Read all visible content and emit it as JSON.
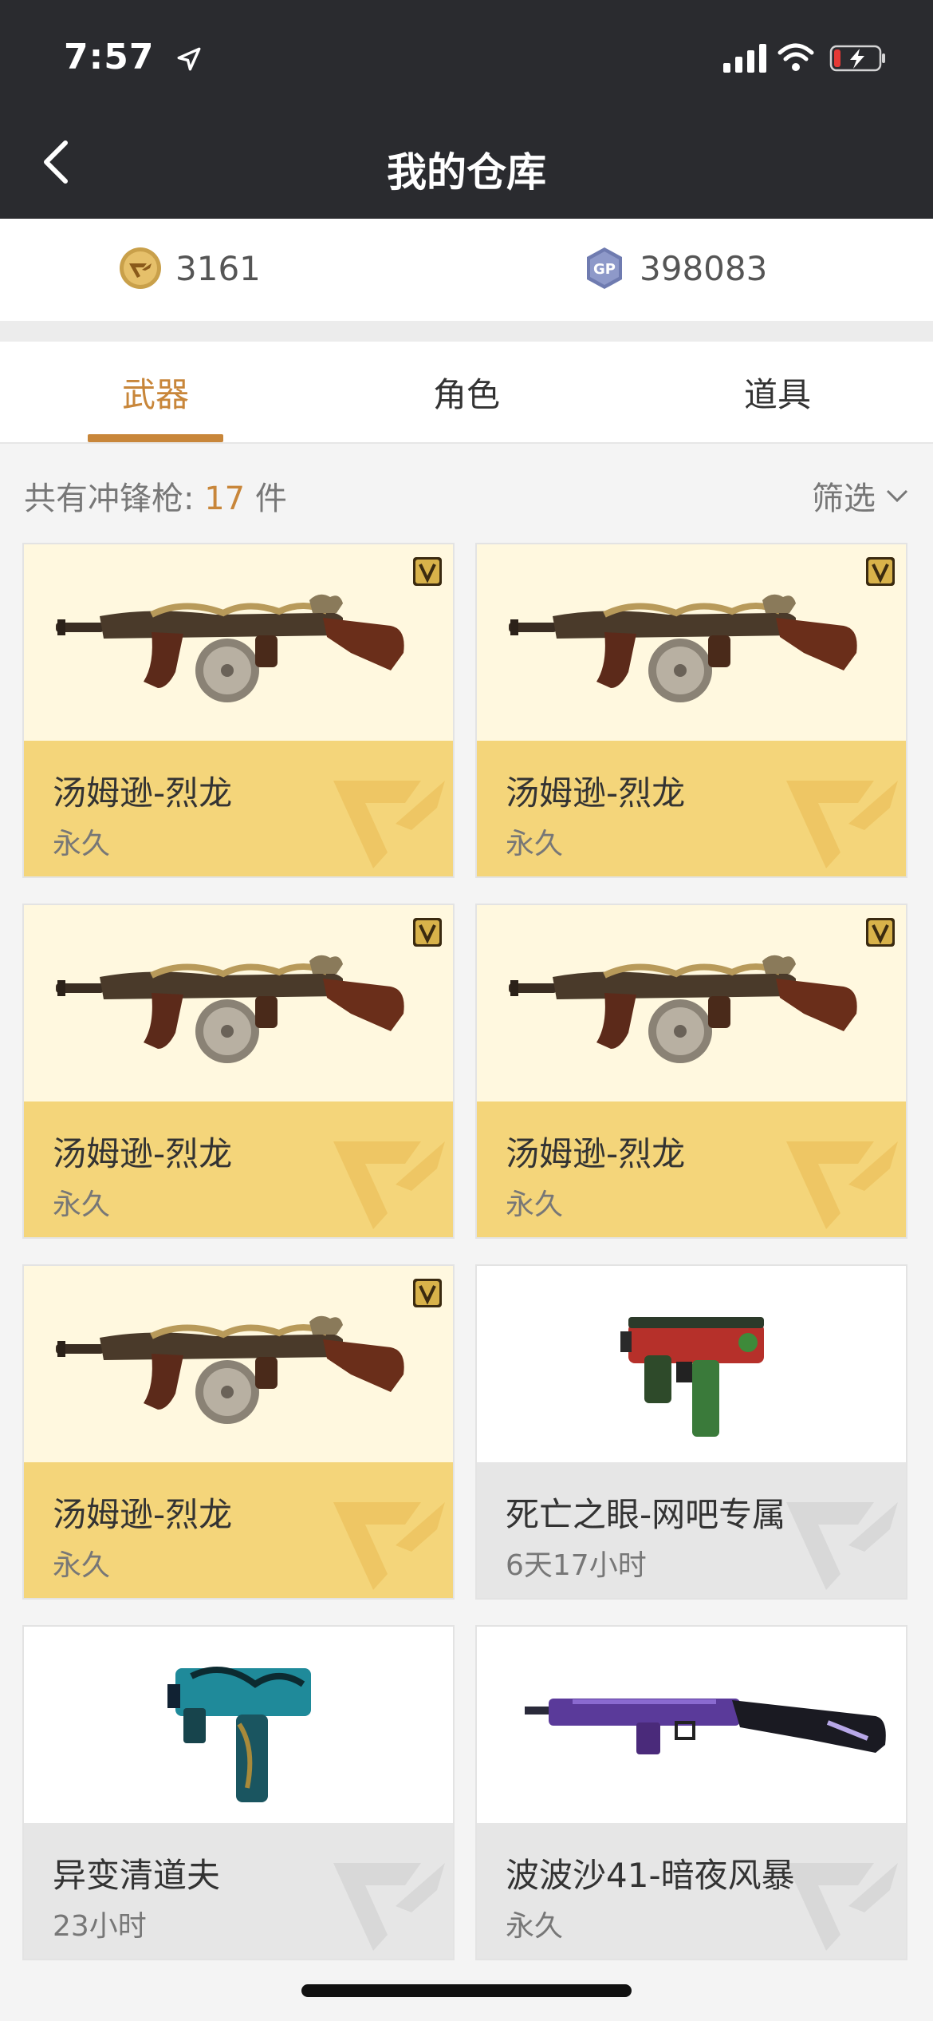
{
  "status": {
    "time": "7:57"
  },
  "header": {
    "title": "我的仓库"
  },
  "currency": {
    "coins": "3161",
    "gp": "398083",
    "gp_badge": "GP"
  },
  "tabs": [
    {
      "label": "武器",
      "active": true
    },
    {
      "label": "角色",
      "active": false
    },
    {
      "label": "道具",
      "active": false
    }
  ],
  "summary": {
    "prefix": "共有冲锋枪: ",
    "count": "17",
    "suffix": " 件"
  },
  "filter": {
    "label": "筛选"
  },
  "items": [
    {
      "name": "汤姆逊-烈龙",
      "duration": "永久",
      "style": "gold",
      "vip": true,
      "weapon_icon": "thompson-dragon"
    },
    {
      "name": "汤姆逊-烈龙",
      "duration": "永久",
      "style": "gold",
      "vip": true,
      "weapon_icon": "thompson-dragon"
    },
    {
      "name": "汤姆逊-烈龙",
      "duration": "永久",
      "style": "gold",
      "vip": true,
      "weapon_icon": "thompson-dragon"
    },
    {
      "name": "汤姆逊-烈龙",
      "duration": "永久",
      "style": "gold",
      "vip": true,
      "weapon_icon": "thompson-dragon"
    },
    {
      "name": "汤姆逊-烈龙",
      "duration": "永久",
      "style": "gold",
      "vip": true,
      "weapon_icon": "thompson-dragon"
    },
    {
      "name": "死亡之眼-网吧专属",
      "duration": "6天17小时",
      "style": "grey",
      "vip": false,
      "weapon_icon": "tmp-red"
    },
    {
      "name": "异变清道夫",
      "duration": "23小时",
      "style": "grey",
      "vip": false,
      "weapon_icon": "tmp-cyan"
    },
    {
      "name": "波波沙41-暗夜风暴",
      "duration": "永久",
      "style": "grey",
      "vip": false,
      "weapon_icon": "ppsh-purple"
    }
  ],
  "colors": {
    "accent": "#c8863a",
    "header_bg": "#2a2b2f",
    "gold_card": "#f4d57a",
    "gold_card_img": "#fff8df",
    "grey_card": "#e6e6e6"
  }
}
